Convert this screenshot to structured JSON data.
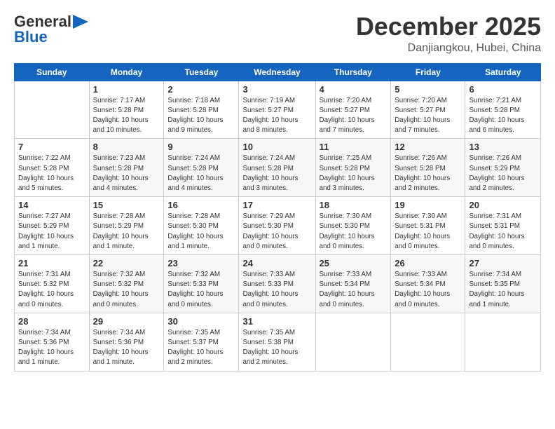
{
  "header": {
    "logo_general": "General",
    "logo_blue": "Blue",
    "month_title": "December 2025",
    "subtitle": "Danjiangkou, Hubei, China"
  },
  "columns": [
    "Sunday",
    "Monday",
    "Tuesday",
    "Wednesday",
    "Thursday",
    "Friday",
    "Saturday"
  ],
  "weeks": [
    [
      {
        "day": "",
        "info": ""
      },
      {
        "day": "1",
        "info": "Sunrise: 7:17 AM\nSunset: 5:28 PM\nDaylight: 10 hours\nand 10 minutes."
      },
      {
        "day": "2",
        "info": "Sunrise: 7:18 AM\nSunset: 5:28 PM\nDaylight: 10 hours\nand 9 minutes."
      },
      {
        "day": "3",
        "info": "Sunrise: 7:19 AM\nSunset: 5:27 PM\nDaylight: 10 hours\nand 8 minutes."
      },
      {
        "day": "4",
        "info": "Sunrise: 7:20 AM\nSunset: 5:27 PM\nDaylight: 10 hours\nand 7 minutes."
      },
      {
        "day": "5",
        "info": "Sunrise: 7:20 AM\nSunset: 5:27 PM\nDaylight: 10 hours\nand 7 minutes."
      },
      {
        "day": "6",
        "info": "Sunrise: 7:21 AM\nSunset: 5:28 PM\nDaylight: 10 hours\nand 6 minutes."
      }
    ],
    [
      {
        "day": "7",
        "info": "Sunrise: 7:22 AM\nSunset: 5:28 PM\nDaylight: 10 hours\nand 5 minutes."
      },
      {
        "day": "8",
        "info": "Sunrise: 7:23 AM\nSunset: 5:28 PM\nDaylight: 10 hours\nand 4 minutes."
      },
      {
        "day": "9",
        "info": "Sunrise: 7:24 AM\nSunset: 5:28 PM\nDaylight: 10 hours\nand 4 minutes."
      },
      {
        "day": "10",
        "info": "Sunrise: 7:24 AM\nSunset: 5:28 PM\nDaylight: 10 hours\nand 3 minutes."
      },
      {
        "day": "11",
        "info": "Sunrise: 7:25 AM\nSunset: 5:28 PM\nDaylight: 10 hours\nand 3 minutes."
      },
      {
        "day": "12",
        "info": "Sunrise: 7:26 AM\nSunset: 5:28 PM\nDaylight: 10 hours\nand 2 minutes."
      },
      {
        "day": "13",
        "info": "Sunrise: 7:26 AM\nSunset: 5:29 PM\nDaylight: 10 hours\nand 2 minutes."
      }
    ],
    [
      {
        "day": "14",
        "info": "Sunrise: 7:27 AM\nSunset: 5:29 PM\nDaylight: 10 hours\nand 1 minute."
      },
      {
        "day": "15",
        "info": "Sunrise: 7:28 AM\nSunset: 5:29 PM\nDaylight: 10 hours\nand 1 minute."
      },
      {
        "day": "16",
        "info": "Sunrise: 7:28 AM\nSunset: 5:30 PM\nDaylight: 10 hours\nand 1 minute."
      },
      {
        "day": "17",
        "info": "Sunrise: 7:29 AM\nSunset: 5:30 PM\nDaylight: 10 hours\nand 0 minutes."
      },
      {
        "day": "18",
        "info": "Sunrise: 7:30 AM\nSunset: 5:30 PM\nDaylight: 10 hours\nand 0 minutes."
      },
      {
        "day": "19",
        "info": "Sunrise: 7:30 AM\nSunset: 5:31 PM\nDaylight: 10 hours\nand 0 minutes."
      },
      {
        "day": "20",
        "info": "Sunrise: 7:31 AM\nSunset: 5:31 PM\nDaylight: 10 hours\nand 0 minutes."
      }
    ],
    [
      {
        "day": "21",
        "info": "Sunrise: 7:31 AM\nSunset: 5:32 PM\nDaylight: 10 hours\nand 0 minutes."
      },
      {
        "day": "22",
        "info": "Sunrise: 7:32 AM\nSunset: 5:32 PM\nDaylight: 10 hours\nand 0 minutes."
      },
      {
        "day": "23",
        "info": "Sunrise: 7:32 AM\nSunset: 5:33 PM\nDaylight: 10 hours\nand 0 minutes."
      },
      {
        "day": "24",
        "info": "Sunrise: 7:33 AM\nSunset: 5:33 PM\nDaylight: 10 hours\nand 0 minutes."
      },
      {
        "day": "25",
        "info": "Sunrise: 7:33 AM\nSunset: 5:34 PM\nDaylight: 10 hours\nand 0 minutes."
      },
      {
        "day": "26",
        "info": "Sunrise: 7:33 AM\nSunset: 5:34 PM\nDaylight: 10 hours\nand 0 minutes."
      },
      {
        "day": "27",
        "info": "Sunrise: 7:34 AM\nSunset: 5:35 PM\nDaylight: 10 hours\nand 1 minute."
      }
    ],
    [
      {
        "day": "28",
        "info": "Sunrise: 7:34 AM\nSunset: 5:36 PM\nDaylight: 10 hours\nand 1 minute."
      },
      {
        "day": "29",
        "info": "Sunrise: 7:34 AM\nSunset: 5:36 PM\nDaylight: 10 hours\nand 1 minute."
      },
      {
        "day": "30",
        "info": "Sunrise: 7:35 AM\nSunset: 5:37 PM\nDaylight: 10 hours\nand 2 minutes."
      },
      {
        "day": "31",
        "info": "Sunrise: 7:35 AM\nSunset: 5:38 PM\nDaylight: 10 hours\nand 2 minutes."
      },
      {
        "day": "",
        "info": ""
      },
      {
        "day": "",
        "info": ""
      },
      {
        "day": "",
        "info": ""
      }
    ]
  ]
}
